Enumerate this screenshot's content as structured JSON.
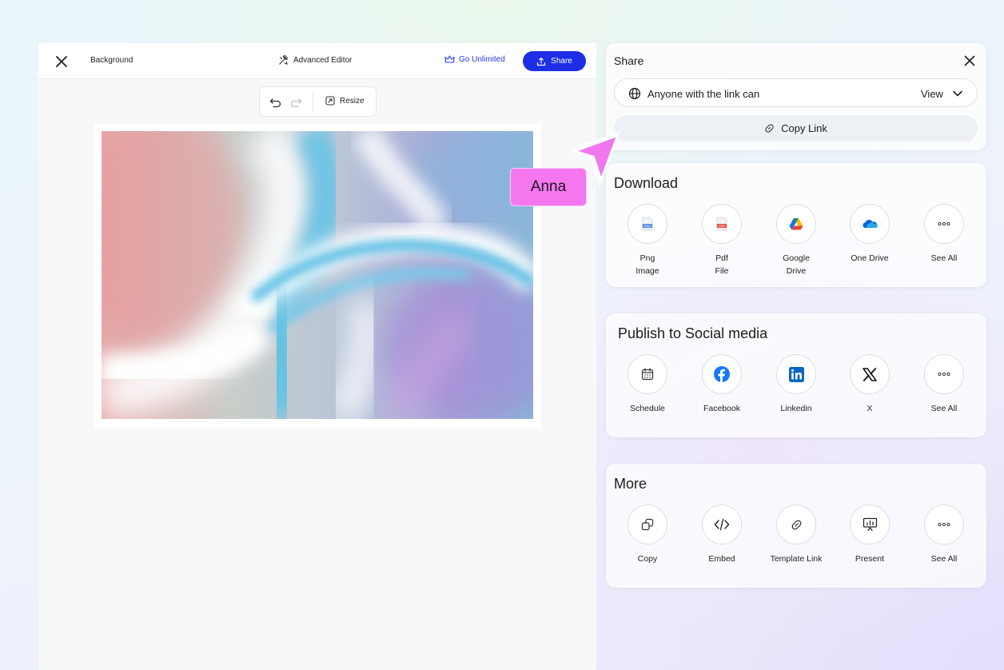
{
  "editor": {
    "title": "Background",
    "advanced_editor_label": "Advanced Editor",
    "go_unlimited_label": "Go Unlimited",
    "share_label": "Share",
    "toolbar": {
      "resize_label": "Resize"
    }
  },
  "share_panel": {
    "title": "Share",
    "access_text": "Anyone with the link can",
    "permission_value": "View",
    "copy_link_label": "Copy Link"
  },
  "download": {
    "title": "Download",
    "items": [
      {
        "label": "Png\nImage",
        "icon": "png-file-icon"
      },
      {
        "label": "Pdf\nFile",
        "icon": "pdf-file-icon"
      },
      {
        "label": "Google\nDrive",
        "icon": "google-drive-icon"
      },
      {
        "label": "One Drive",
        "icon": "onedrive-icon"
      },
      {
        "label": "See All",
        "icon": "more-dots-icon"
      }
    ]
  },
  "social": {
    "title": "Publish to Social media",
    "items": [
      {
        "label": "Schedule",
        "icon": "calendar-icon"
      },
      {
        "label": "Facebook",
        "icon": "facebook-icon"
      },
      {
        "label": "Linkedin",
        "icon": "linkedin-icon"
      },
      {
        "label": "X",
        "icon": "x-logo-icon"
      },
      {
        "label": "See All",
        "icon": "more-dots-icon"
      }
    ]
  },
  "more": {
    "title": "More",
    "items": [
      {
        "label": "Copy",
        "icon": "copy-icon"
      },
      {
        "label": "Embed",
        "icon": "code-icon"
      },
      {
        "label": "Template Link",
        "icon": "link-icon"
      },
      {
        "label": "Present",
        "icon": "presentation-icon"
      },
      {
        "label": "See All",
        "icon": "more-dots-icon"
      }
    ]
  },
  "collaborator": {
    "name": "Anna",
    "color": "#f577f0"
  },
  "colors": {
    "accent": "#1d2ee6",
    "accent_text": "#2b39e8"
  }
}
